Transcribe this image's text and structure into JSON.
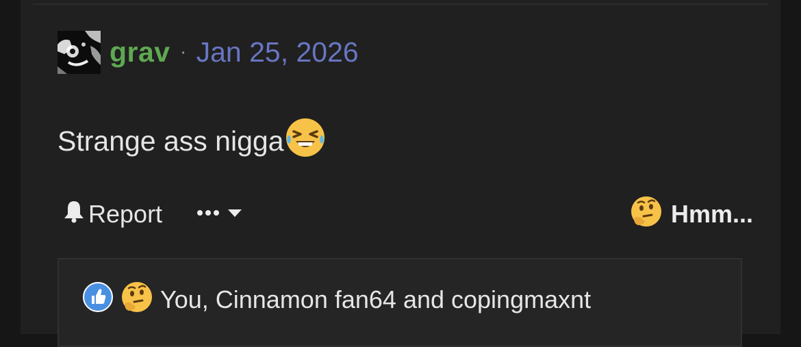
{
  "post": {
    "author": "grav",
    "separator": "·",
    "date": "Jan 25, 2026",
    "message": "Strange ass nigga",
    "message_emoji": "laughing-tears-emoji"
  },
  "actions": {
    "report_label": "Report",
    "more_label": "•••",
    "reaction_label": "Hmm...",
    "reaction_emoji": "thinking-face-emoji"
  },
  "reactions": {
    "icons": [
      "like-icon",
      "thinking-face-emoji"
    ],
    "summary": "You, Cinnamon fan64 and copingmaxnt"
  },
  "colors": {
    "username": "#5fa852",
    "date": "#6876c2",
    "background": "#202020",
    "like_blue": "#4a90e2",
    "emoji_yellow": "#f7c248"
  }
}
